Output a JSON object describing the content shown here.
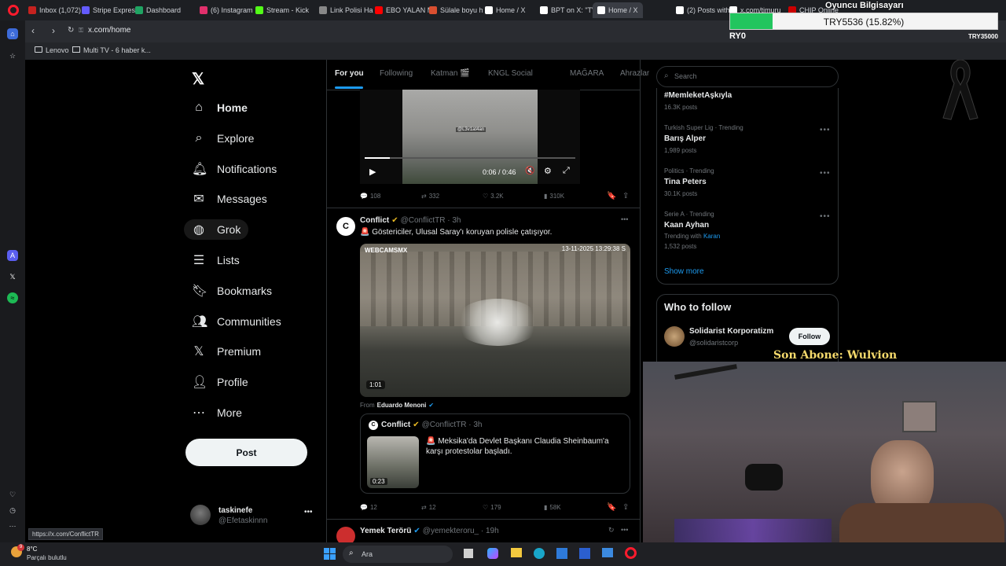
{
  "browser": {
    "tabs": [
      {
        "label": "Inbox (1,072)",
        "color": "#c5221f"
      },
      {
        "label": "Stripe Express",
        "color": "#635bff"
      },
      {
        "label": "Dashboard",
        "color": "#1fa463"
      },
      {
        "label": "(6) Instagram",
        "color": "#e1306c"
      },
      {
        "label": "Stream - Kick",
        "color": "#53fc18"
      },
      {
        "label": "Link Polisi Ha",
        "color": "#888888"
      },
      {
        "label": "EBO YALAN M",
        "color": "#ff0000"
      },
      {
        "label": "Sülale boyu h",
        "color": "#d94f30"
      },
      {
        "label": "Home / X",
        "color": "#ffffff"
      },
      {
        "label": "BPT on X: \"TV",
        "color": "#ffffff"
      },
      {
        "label": "Home / X",
        "color": "#ffffff"
      },
      {
        "label": "(2) Posts with",
        "color": "#ffffff"
      },
      {
        "label": "x.com/timuru",
        "color": "#ffffff"
      },
      {
        "label": "CHIP Online",
        "color": "#cc0000"
      }
    ],
    "url": "x.com/home",
    "bookmarks": [
      "Lenovo",
      "Multi TV - 6 haber k..."
    ],
    "status_url": "https://x.com/ConflictTR"
  },
  "stream_overlay": {
    "title": "Oyuncu Bilgisayarı",
    "goal_text": "TRY5536 (15.82%)",
    "goal_progress": 0.1582,
    "left_label": "RY0",
    "right_label": "TRY35000",
    "subscriber_text": "Son Abone: Wulvion"
  },
  "x": {
    "nav": [
      {
        "label": "Home",
        "icon": "home-icon"
      },
      {
        "label": "Explore",
        "icon": "search-icon"
      },
      {
        "label": "Notifications",
        "icon": "bell-icon"
      },
      {
        "label": "Messages",
        "icon": "mail-icon"
      },
      {
        "label": "Grok",
        "icon": "grok-icon"
      },
      {
        "label": "Lists",
        "icon": "list-icon"
      },
      {
        "label": "Bookmarks",
        "icon": "bookmark-icon"
      },
      {
        "label": "Communities",
        "icon": "people-icon"
      },
      {
        "label": "Premium",
        "icon": "x-logo-icon"
      },
      {
        "label": "Profile",
        "icon": "person-icon"
      },
      {
        "label": "More",
        "icon": "more-circle-icon"
      }
    ],
    "post_label": "Post",
    "account": {
      "name": "taskinefe",
      "handle": "@Efetaskinnn"
    },
    "tabs": [
      "For you",
      "Following",
      "Katman 🎬",
      "KNGL Social",
      "MAĞARA",
      "Ahrazlar"
    ],
    "video1": {
      "time": "0:06 / 0:46",
      "watermark": "@L3v1at4an",
      "metrics": {
        "replies": "108",
        "reposts": "332",
        "likes": "3.2K",
        "views": "310K"
      }
    },
    "post2": {
      "author": "Conflict",
      "handle": "@ConflictTR · 3h",
      "text": "🚨 Göstericiler, Ulusal Saray'ı koruyan polisle çatışıyor.",
      "video_overlay_left": "WEBCAMSMX",
      "video_overlay_right": "13-11-2025 13:29:38 S",
      "duration": "1:01",
      "from_label": "From",
      "from_name": "Eduardo Menoni",
      "quote": {
        "author": "Conflict",
        "handle": "@ConflictTR · 3h",
        "text": "🚨 Meksika'da Devlet Başkanı Claudia Sheinbaum'a karşı protestolar başladı.",
        "duration": "0:23"
      },
      "metrics": {
        "replies": "12",
        "reposts": "12",
        "likes": "179",
        "views": "58K"
      }
    },
    "post3": {
      "author": "Yemek Terörü",
      "handle": "@yemekteroru_ · 19h"
    },
    "search_placeholder": "Search",
    "trends": [
      {
        "category": "",
        "name": "#MemleketAşkıyla",
        "count": "16.3K posts"
      },
      {
        "category": "Turkish Super Lig · Trending",
        "name": "Barış Alper",
        "count": "1,989 posts"
      },
      {
        "category": "Politics · Trending",
        "name": "Tina Peters",
        "count": "30.1K posts"
      },
      {
        "category": "Serie A · Trending",
        "name": "Kaan Ayhan",
        "count": "1,532 posts",
        "with_label": "Trending with",
        "with_name": "Karan"
      }
    ],
    "show_more": "Show more",
    "who_to_follow": {
      "title": "Who to follow",
      "name": "Solidarist Korporatizm",
      "handle": "@solidaristcorp",
      "follow_label": "Follow"
    }
  },
  "taskbar": {
    "weather_temp": "8°C",
    "weather_desc": "Parçalı bulutlu",
    "search_label": "Ara",
    "notification_count": "9"
  },
  "colors": {
    "accent": "#1d9bf0",
    "background": "#000000",
    "border": "#2f3336",
    "muted": "#71767b",
    "goal_green": "#22c55e"
  }
}
